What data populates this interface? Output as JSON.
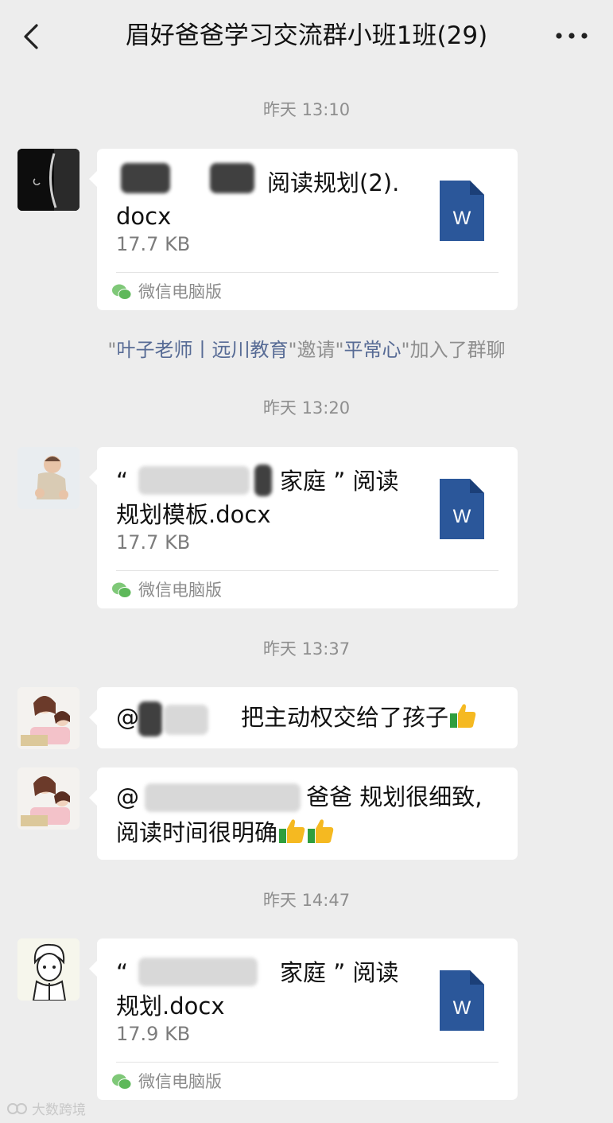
{
  "header": {
    "title": "眉好爸爸学习交流群小班1班(29)",
    "back_icon": "chevron-left-icon",
    "more_icon": "more-dots-icon"
  },
  "timestamps": [
    "昨天 13:10",
    "昨天 13:20",
    "昨天 13:37",
    "昨天 14:47"
  ],
  "messages": [
    {
      "type": "file",
      "avatar": "moon-avatar",
      "name_line1": "阅读规划(2).",
      "name_line2": "docx",
      "size": "17.7 KB",
      "source": "微信电脑版",
      "icon": "word-doc-icon"
    },
    {
      "type": "file",
      "avatar": "baby-avatar",
      "name_line1_start": "“",
      "name_line1": "家庭 ” 阅读",
      "name_line2": "规划模板.docx",
      "size": "17.7 KB",
      "source": "微信电脑版",
      "icon": "word-doc-icon"
    },
    {
      "type": "text",
      "avatar": "mother-child-avatar",
      "mention": "@",
      "text": "把主动权交给了孩子"
    },
    {
      "type": "text",
      "avatar": "mother-child-avatar",
      "mention": "@",
      "line1": "爸爸   规划很细致,",
      "line2": "阅读时间很明确"
    },
    {
      "type": "file",
      "avatar": "cartoon-boy-avatar",
      "name_line1_start": "“",
      "name_line1": "家庭 ” 阅读",
      "name_line2": "规划.docx",
      "size": "17.9 KB",
      "source": "微信电脑版",
      "icon": "word-doc-icon"
    }
  ],
  "system_notice": {
    "q1": "\"",
    "inviter": "叶子老师丨远川教育",
    "mid": "\"邀请\"",
    "invitee": "平常心",
    "end": "\"加入了群聊"
  },
  "word_icon_letter": "W",
  "watermark": "大数跨境",
  "colors": {
    "background": "#ededed",
    "bubble": "#ffffff",
    "link": "#576b95",
    "word_blue": "#2b579a",
    "thumb_yellow": "#f5b921",
    "thumb_green": "#2f9e3e"
  }
}
